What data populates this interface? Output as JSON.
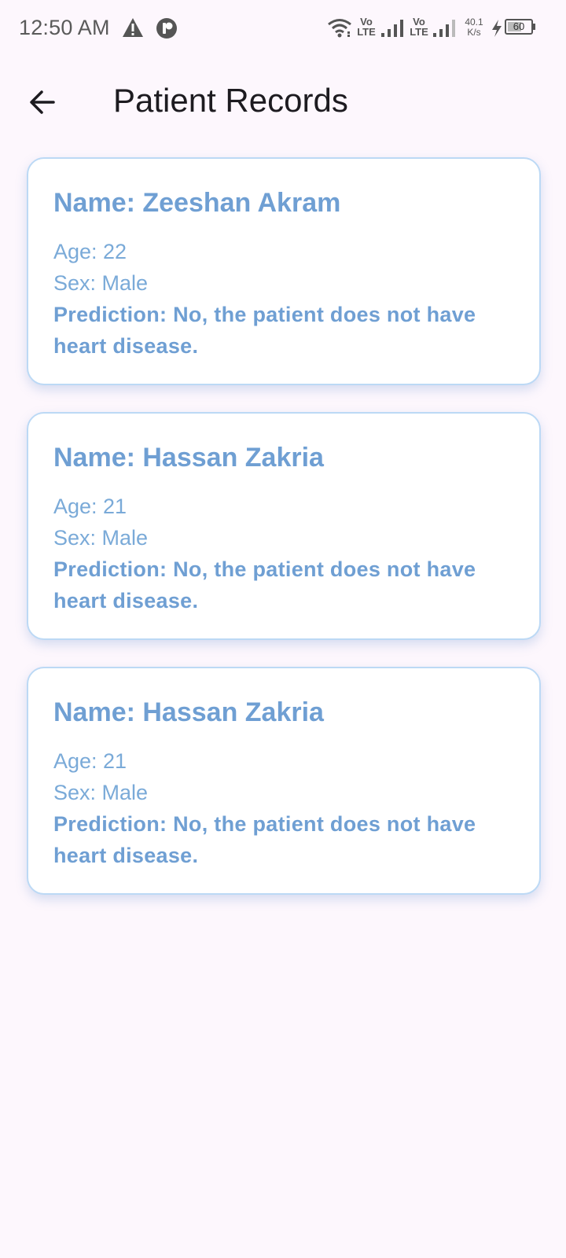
{
  "status_bar": {
    "time": "12:50 AM",
    "net_speed_value": "40.1",
    "net_speed_unit": "K/s",
    "battery_level": "60",
    "volte_label_1_top": "Vo",
    "volte_label_1_bottom": "LTE",
    "volte_label_2_top": "Vo",
    "volte_label_2_bottom": "LTE",
    "icons": [
      "warning-icon",
      "app-notification-icon",
      "wifi-icon",
      "signal-icon",
      "signal-icon",
      "charging-icon",
      "battery-icon"
    ]
  },
  "app_bar": {
    "title": "Patient Records",
    "back_icon": "arrow-back-icon"
  },
  "records": [
    {
      "name": "Name: Zeeshan Akram",
      "age": "Age: 22",
      "sex": "Sex: Male",
      "prediction": "Prediction: No, the patient does not have heart disease."
    },
    {
      "name": "Name: Hassan Zakria",
      "age": "Age: 21",
      "sex": "Sex: Male",
      "prediction": "Prediction: No, the patient does not have heart disease."
    },
    {
      "name": "Name: Hassan Zakria",
      "age": "Age: 21",
      "sex": "Sex: Male",
      "prediction": "Prediction: No, the patient does not have heart disease."
    }
  ],
  "colors": {
    "background": "#fdf7fd",
    "card_border": "#bcd9f5",
    "accent_text": "#6f9fd3"
  }
}
